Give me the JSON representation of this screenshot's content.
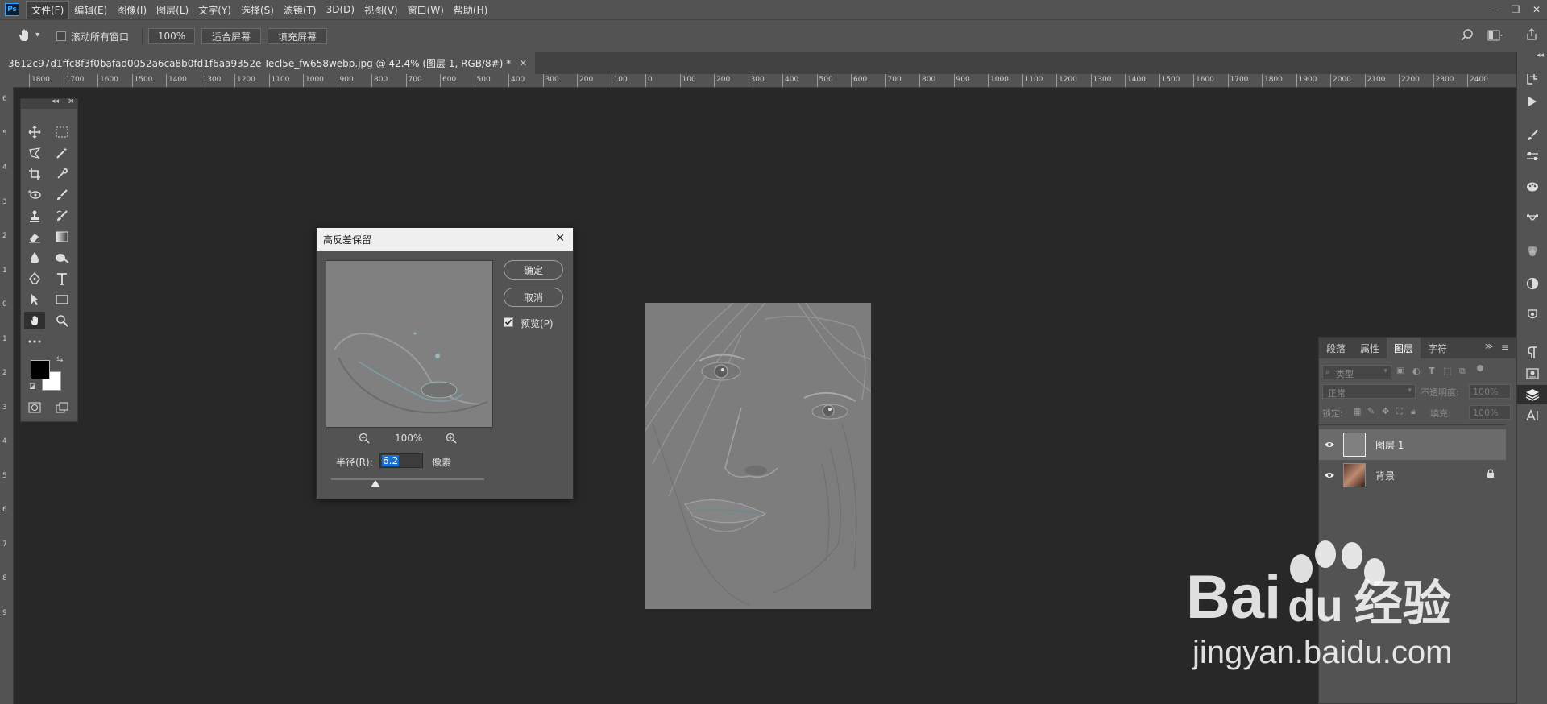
{
  "app": {
    "logo": "Ps"
  },
  "menu": [
    "文件(F)",
    "编辑(E)",
    "图像(I)",
    "图层(L)",
    "文字(Y)",
    "选择(S)",
    "滤镜(T)",
    "3D(D)",
    "视图(V)",
    "窗口(W)",
    "帮助(H)"
  ],
  "window_controls": {
    "minimize": "—",
    "restore": "❐",
    "close": "✕"
  },
  "options": {
    "hand_icon": "hand-icon",
    "scroll_all_label": "滚动所有窗口",
    "zoom_value": "100%",
    "fit_screen": "适合屏幕",
    "fill_screen": "填充屏幕"
  },
  "document_tab": {
    "title": "3612c97d1ffc8f3f0bafad0052a6ca8b0fd1f6aa9352e-Tecl5e_fw658webp.jpg @ 42.4% (图层 1, RGB/8#) *",
    "close": "×"
  },
  "ruler_h_labels": [
    "1800",
    "1700",
    "1600",
    "1500",
    "1400",
    "1300",
    "1200",
    "1100",
    "1000",
    "900",
    "800",
    "700",
    "600",
    "500",
    "400",
    "300",
    "200",
    "100",
    "0",
    "100",
    "200",
    "300",
    "400",
    "500",
    "600",
    "700",
    "800",
    "900",
    "1000",
    "1100",
    "1200",
    "1300",
    "1400",
    "1500",
    "1600",
    "1700",
    "1800",
    "1900",
    "2000",
    "2100",
    "2200",
    "2300",
    "2400"
  ],
  "ruler_v_labels": [
    "6",
    "5",
    "4",
    "3",
    "2",
    "1",
    "0",
    "1",
    "2",
    "3",
    "4",
    "5",
    "6",
    "7",
    "8",
    "9"
  ],
  "dialog": {
    "title": "高反差保留",
    "close": "✕",
    "ok": "确定",
    "cancel": "取消",
    "preview_label": "预览(P)",
    "preview_checked": true,
    "zoom": "100%",
    "radius_label": "半径(R):",
    "radius_value": "6.2",
    "unit": "像素",
    "slider_fraction": 0.29
  },
  "panel": {
    "tabs": [
      "段落",
      "属性",
      "图层",
      "字符"
    ],
    "active_tab": "图层",
    "filter_placeholder": "类型",
    "blend_mode": "正常",
    "opacity_label": "不透明度:",
    "opacity_value": "100%",
    "lock_label": "锁定:",
    "fill_label": "填充:",
    "fill_value": "100%",
    "layers": [
      {
        "name": "图层 1",
        "selected": true,
        "locked": false
      },
      {
        "name": "背景",
        "selected": false,
        "locked": true
      }
    ]
  },
  "watermark": {
    "brand_left": "Bai",
    "brand_mid": "du",
    "brand_right": "经验",
    "url": "jingyan.baidu.com"
  },
  "colors": {
    "ui_gray": "#535353",
    "canvas_bg": "#282828",
    "selection_blue": "#1a6fd6",
    "ps_blue": "#31a8ff"
  }
}
